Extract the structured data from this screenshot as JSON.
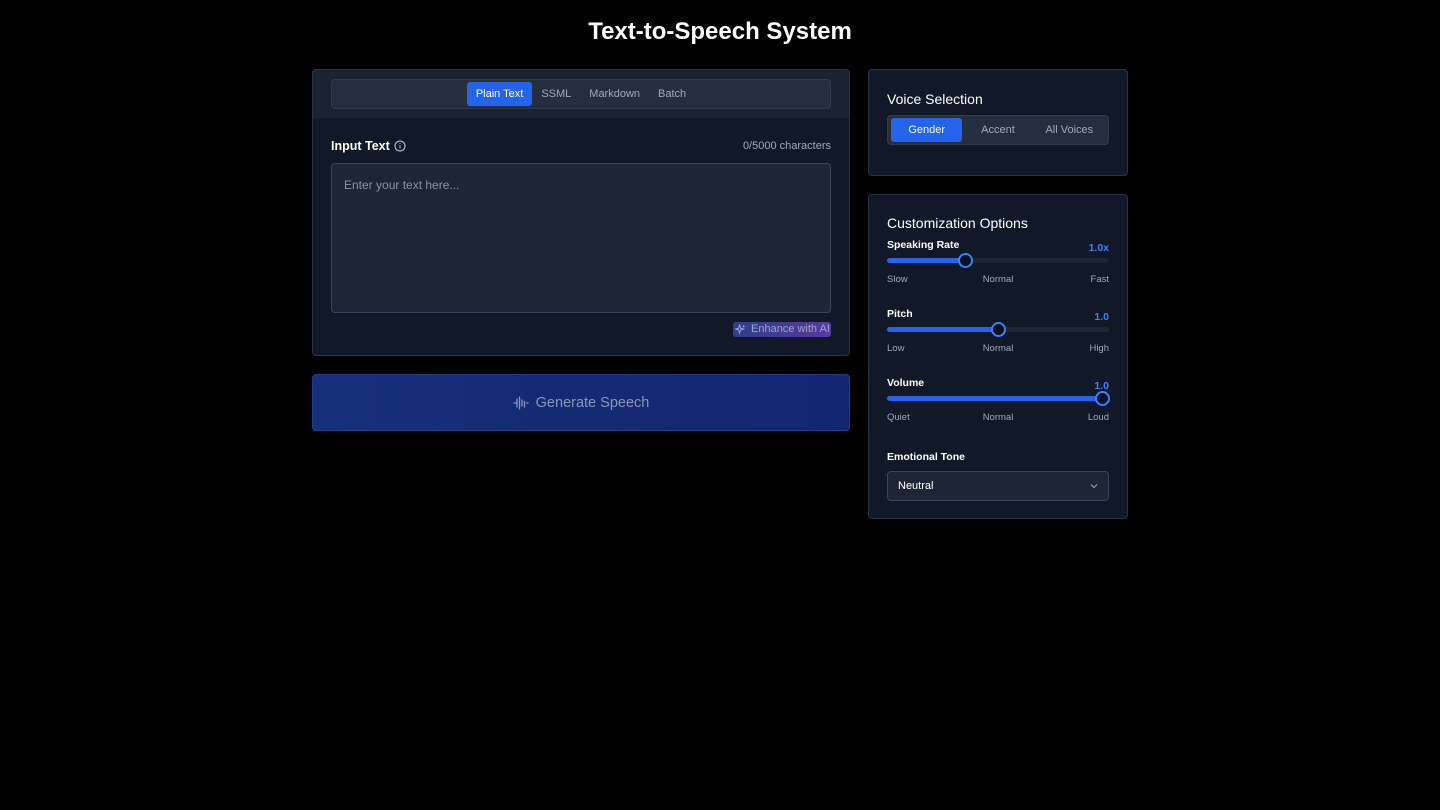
{
  "page": {
    "title": "Text-to-Speech System"
  },
  "editor": {
    "tabs": [
      {
        "label": "Plain Text",
        "active": true
      },
      {
        "label": "SSML",
        "active": false
      },
      {
        "label": "Markdown",
        "active": false
      },
      {
        "label": "Batch",
        "active": false
      }
    ],
    "input_label": "Input Text",
    "char_count": "0/5000 characters",
    "value": "",
    "placeholder": "Enter your text here...",
    "enhance_label": "Enhance with AI"
  },
  "generate": {
    "label": "Generate Speech"
  },
  "voice": {
    "title": "Voice Selection",
    "tabs": [
      {
        "label": "Gender",
        "active": true
      },
      {
        "label": "Accent",
        "active": false
      },
      {
        "label": "All Voices",
        "active": false
      }
    ]
  },
  "custom": {
    "title": "Customization Options",
    "rate": {
      "label": "Speaking Rate",
      "value": "1.0x",
      "level": 0.35,
      "min": "Slow",
      "mid": "Normal",
      "max": "Fast"
    },
    "pitch": {
      "label": "Pitch",
      "value": "1.0",
      "level": 0.5,
      "min": "Low",
      "mid": "Normal",
      "max": "High"
    },
    "volume": {
      "label": "Volume",
      "value": "1.0",
      "level": 0.97,
      "min": "Quiet",
      "mid": "Normal",
      "max": "Loud"
    },
    "tone": {
      "label": "Emotional Tone",
      "selected": "Neutral"
    }
  },
  "colors": {
    "accent": "#2563eb",
    "background": "#000000",
    "card": "#111827"
  },
  "icons": {
    "info": "info-icon",
    "enhance": "sparkles-icon",
    "generate": "waveform-icon",
    "dropdown": "chevron-down-icon"
  }
}
